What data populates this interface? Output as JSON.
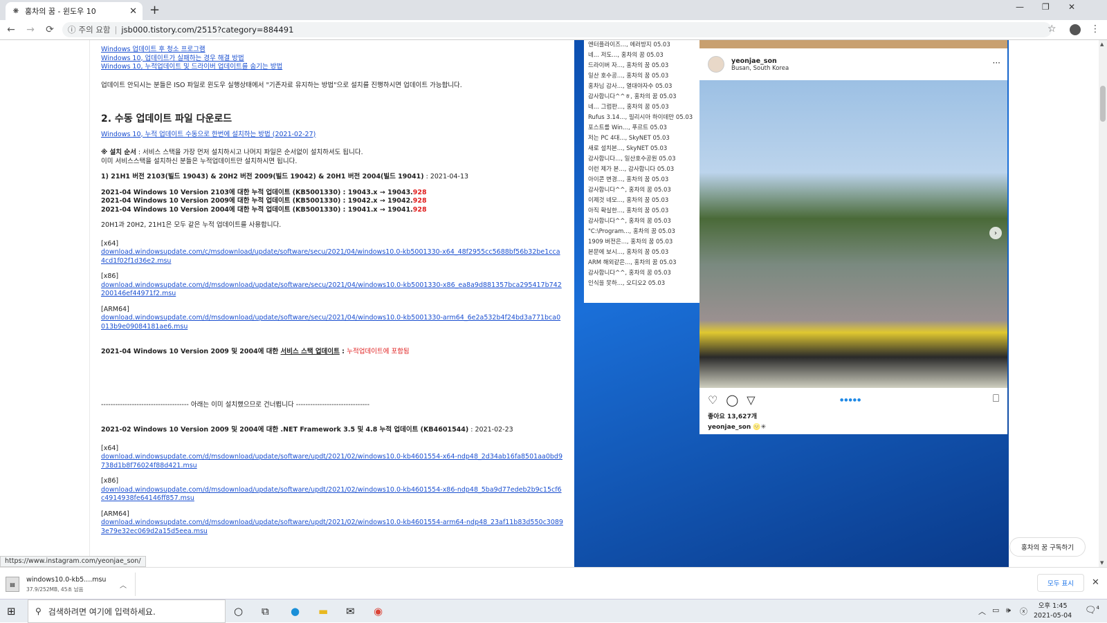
{
  "browser": {
    "tab_title": "홍차의 꿈 - 윈도우 10",
    "tab_favicon": "tistory-icon",
    "new_tab": "+",
    "tab_close": "✕",
    "window_minimize": "—",
    "window_restore": "❐",
    "window_close": "✕",
    "security_label": "주의 요함",
    "url": "jsb000.tistory.com/2515?category=884491",
    "status_url": "https://www.instagram.com/yeonjae_son/"
  },
  "article": {
    "top_links": [
      "Windows 업데이트 후 청소 프로그램",
      "Windows 10, 업데이트가 실패하는 경우 해결 방법",
      "Windows 10, 누적업데이트 및 드라이버 업데이트를 숨기는 방법"
    ],
    "iso_note": "업데이트 안되시는 분들은 ISO 파일로 윈도우 실행상태에서 \"기존자료 유지하는 방법\"으로 설치를 진행하시면 업데이트 가능합니다.",
    "section2_title": "2. 수동 업데이트 파일 다운로드",
    "section2_link": "Windows 10, 누적 업데이트 수동으로 한번에 설치하는 방법 (2021-02-27)",
    "install_order_label": "※ 설치 순서",
    "install_order_text": " : 서비스 스택을 가장 먼저 설치하시고 나머지 파일은 순서없이 설치하셔도 됩니다.",
    "install_order_text2": "이미 서비스스택을 설치하신 분들은 누적업데이트만 설치하시면 됩니다.",
    "version_heading": "1) 21H1 버전 2103(빌드 19043) & 20H2 버전 2009(빌드 19042) & 20H1 버전 2004(빌드 19041)",
    "version_date": " : 2021-04-13",
    "updates": [
      {
        "text": "2021-04 Windows 10 Version 2103에 대한 누적 업데이트 (KB5001330) : 19043.x → 19043.",
        "build": "928"
      },
      {
        "text": "2021-04 Windows 10 Version 2009에 대한 누적 업데이트 (KB5001330) : 19042.x → 19042.",
        "build": "928"
      },
      {
        "text": "2021-04 Windows 10 Version 2004에 대한 누적 업데이트 (KB5001330) : 19041.x → 19041.",
        "build": "928"
      }
    ],
    "same_update_note": "20H1과 20H2, 21H1은 모두 같은 누적 업데이트를 사용합니다.",
    "downloads_1": [
      {
        "arch": "[x64]",
        "url": "download.windowsupdate.com/c/msdownload/update/software/secu/2021/04/windows10.0-kb5001330-x64_48f2955cc5688bf56b32be1cca4cd1f02f1d36e2.msu"
      },
      {
        "arch": "[x86]",
        "url": "download.windowsupdate.com/d/msdownload/update/software/secu/2021/04/windows10.0-kb5001330-x86_ea8a9d881357bca295417b742200146ef44971f2.msu"
      },
      {
        "arch": "[ARM64]",
        "url": "download.windowsupdate.com/d/msdownload/update/software/secu/2021/04/windows10.0-kb5001330-arm64_6e2a532b4f24bd3a771bca0013b9e09084181ae6.msu"
      }
    ],
    "ssu_text": "2021-04 Windows 10 Version 2009 및 2004에 대한 ",
    "ssu_link": "서비스 스택 업데이트",
    "ssu_sep": " : ",
    "ssu_red": "누적업데이트에 포함됨",
    "divider": "------------------------------------- 아래는 이미 설치했으므로 건너뜁니다 -------------------------------",
    "net_heading": "2021-02 Windows 10 Version 2009 및 2004에 대한 .NET Framework 3.5 및 4.8 누적 업데이트 (KB4601544)",
    "net_date": " : 2021-02-23",
    "downloads_2": [
      {
        "arch": "[x64]",
        "url": "download.windowsupdate.com/d/msdownload/update/software/updt/2021/02/windows10.0-kb4601554-x64-ndp48_2d34ab16fa8501aa0bd9738d1b8f76024f88d421.msu"
      },
      {
        "arch": "[x86]",
        "url": "download.windowsupdate.com/d/msdownload/update/software/updt/2021/02/windows10.0-kb4601554-x86-ndp48_5ba9d77edeb2b9c15cf6c4914938fe64146ff857.msu"
      },
      {
        "arch": "[ARM64]",
        "url": "download.windowsupdate.com/d/msdownload/update/software/updt/2021/02/windows10.0-kb4601554-arm64-ndp48_23af11b83d550c30893e79e32ec069d2a15d5eea.msu"
      }
    ]
  },
  "comments": [
    "엔터플라이즈..., 에러방지 05.03",
    "네... 저도..., 홍차의 꿈 05.03",
    "드라이버 자..., 홍차의 꿈 05.03",
    "일산 호수공..., 홍차의 꿈 05.03",
    "홍차님 감사..., 열대야자수 05.03",
    "감사합니다^^ㅎ, 홍차의 꿈 05.03",
    "네... 그럼판..., 홍차의 꿈 05.03",
    "Rufus 3.14..., 필리시아 하이데만 05.03",
    "포스트를 Win..., 푸르트 05.03",
    "저는 PC 4대..., SkyNET 05.03",
    "새로 설치본..., SkyNET 05.03",
    "감사합니다..., 일산호수공원 05.03",
    "이런 제가 본..., 감사합니다 05.03",
    "아이콘 변경..., 홍차의 꿈 05.03",
    "감사합니다^^, 홍차의 꿈 05.03",
    "이제것 네모..., 홍차의 꿈 05.03",
    "아직 확실한..., 홍차의 꿈 05.03",
    "감사합니다^^, 홍차의 꿈 05.03",
    "\"C:\\Program..., 홍차의 꿈 05.03",
    "1909 버전은..., 홍차의 꿈 05.03",
    "본문에 보시..., 홍차의 꿈 05.03",
    "ARM 해외같은..., 홍차의 꿈 05.03",
    "감사합니다^^, 홍차의 꿈 05.03",
    "인식을 못하..., 오디오2 05.03"
  ],
  "instagram": {
    "username": "yeonjae_son",
    "location": "Busan, South Korea",
    "more": "···",
    "likes": "좋아요 13,627개",
    "caption_user": "yeonjae_son",
    "caption_emoji": "🌝✳",
    "next_arrow": "›",
    "carousel_dots": "●●●●●"
  },
  "subscribe_label": "홍차의 꿈 구독하기",
  "download": {
    "filename": "windows10.0-kb5....msu",
    "progress": "37.9/252MB, 45초 남음",
    "show_all": "모두 표시",
    "close": "✕"
  },
  "taskbar": {
    "search_placeholder": "검색하려면 여기에 입력하세요.",
    "time": "오후 1:45",
    "date": "2021-05-04",
    "notif_count": "4"
  }
}
